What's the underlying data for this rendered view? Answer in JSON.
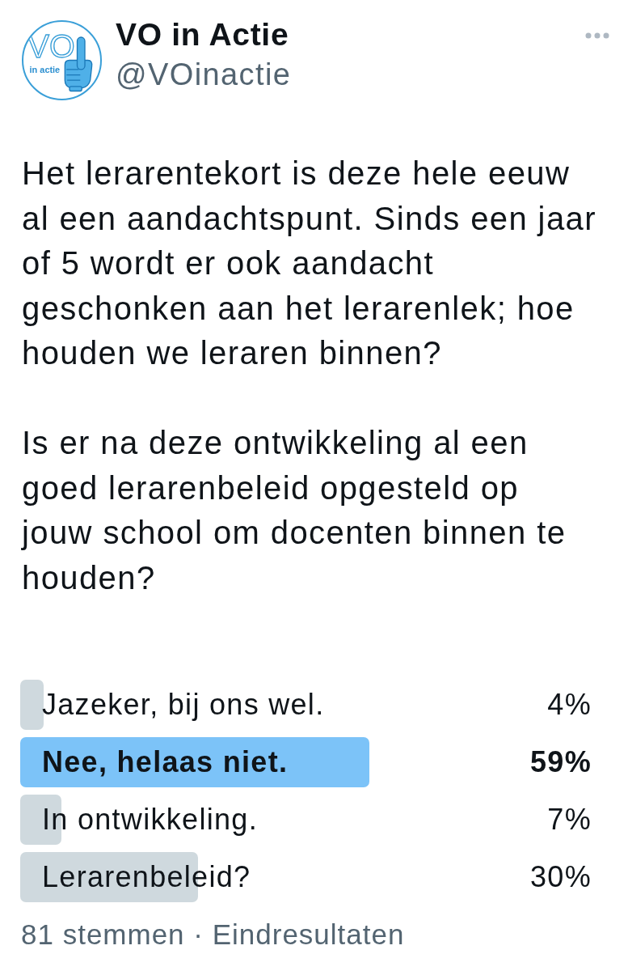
{
  "author": {
    "name": "VO in Actie",
    "handle": "@VOinactie",
    "avatar": {
      "logo_text": "VO",
      "logo_subtext": "in actie"
    }
  },
  "paragraphs": [
    "Het lerarentekort is deze hele eeuw\nal een aandachtspunt. Sinds een jaar\nof 5 wordt er ook aandacht\ngeschonken aan het lerarenlek; hoe\nhouden we leraren binnen?",
    "Is er na deze ontwikkeling al een\ngoed lerarenbeleid opgesteld op\njouw school om docenten binnen te\nhouden?"
  ],
  "poll": {
    "options": [
      {
        "label": "Jazeker, bij ons wel.",
        "percent": "4%",
        "level": 0.04,
        "winner": false
      },
      {
        "label": "Nee, helaas niet.",
        "percent": "59%",
        "level": 0.59,
        "winner": true
      },
      {
        "label": "In ontwikkeling.",
        "percent": "7%",
        "level": 0.07,
        "winner": false
      },
      {
        "label": "Lerarenbeleid?",
        "percent": "30%",
        "level": 0.3,
        "winner": false
      }
    ],
    "summary": "81 stemmen · Eindresultaten"
  }
}
